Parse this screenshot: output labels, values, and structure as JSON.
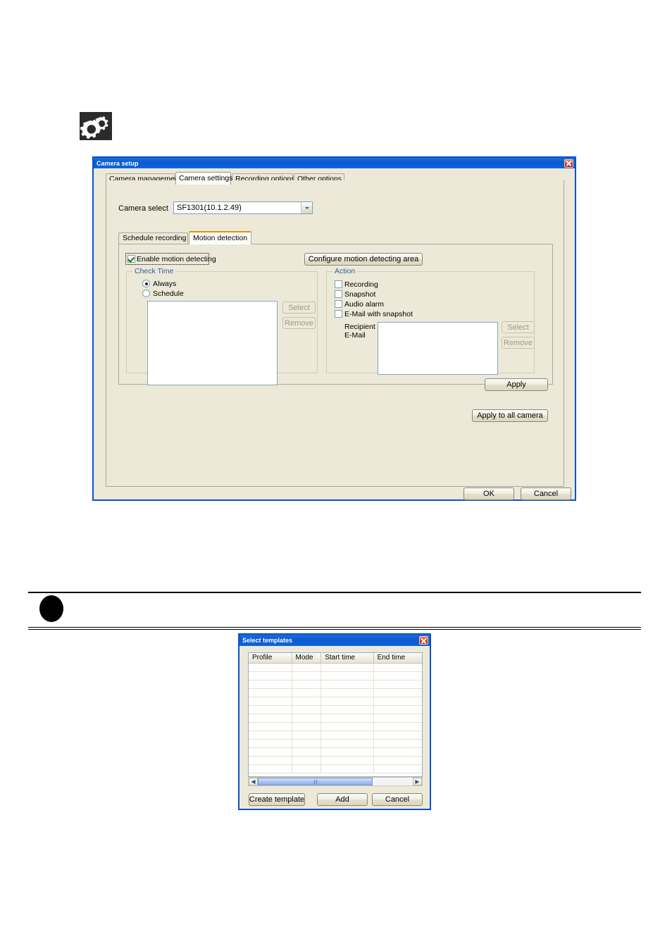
{
  "page": {
    "gear_icon": "gears-icon"
  },
  "camera_setup": {
    "title": "Camera setup",
    "close_label": "x",
    "tabs": [
      {
        "label": "Camera management",
        "selected": false
      },
      {
        "label": "Camera settings",
        "selected": true
      },
      {
        "label": "Recording options",
        "selected": false
      },
      {
        "label": "Other options",
        "selected": false
      }
    ],
    "camera_select_label": "Camera select",
    "camera_select_value": "SF1301(10.1.2.49)",
    "inner_tabs": [
      {
        "label": "Schedule recording",
        "selected": false
      },
      {
        "label": "Motion detection",
        "selected": true
      }
    ],
    "enable_motion_detecting": "Enable motion detecting",
    "enable_motion_detecting_checked": true,
    "configure_button": "Configure motion detecting area",
    "check_time": {
      "title": "Check Time",
      "always": "Always",
      "schedule": "Schedule",
      "selected": "Always",
      "select_button": "Select",
      "remove_button": "Remove",
      "list_value": ""
    },
    "action": {
      "title": "Action",
      "items": [
        {
          "label": "Recording",
          "checked": false
        },
        {
          "label": "Snapshot",
          "checked": false
        },
        {
          "label": "Audio alarm",
          "checked": false
        },
        {
          "label": "E-Mail with snapshot",
          "checked": false
        }
      ],
      "recipient_label_line1": "Recipient",
      "recipient_label_line2": "E-Mail",
      "recipient_value": "",
      "select_button": "Select",
      "remove_button": "Remove"
    },
    "apply_button": "Apply",
    "apply_all_button": "Apply to all camera",
    "ok_button": "OK",
    "cancel_button": "Cancel"
  },
  "select_templates": {
    "title": "Select templates",
    "close_label": "x",
    "columns": [
      "Profile",
      "Mode",
      "Start time",
      "End time"
    ],
    "rows": [],
    "row_count": 13,
    "scroll_left_icon": "◀",
    "scroll_right_icon": "▶",
    "create_template_button": "Create template",
    "add_button": "Add",
    "cancel_button": "Cancel"
  },
  "colors": {
    "titlebar_blue": "#0a5ad0",
    "dialog_face": "#ece9d8",
    "group_label_blue": "#2e5f9e",
    "active_inner_tab_orange": "#e09010",
    "close_red": "#d83a1c"
  }
}
